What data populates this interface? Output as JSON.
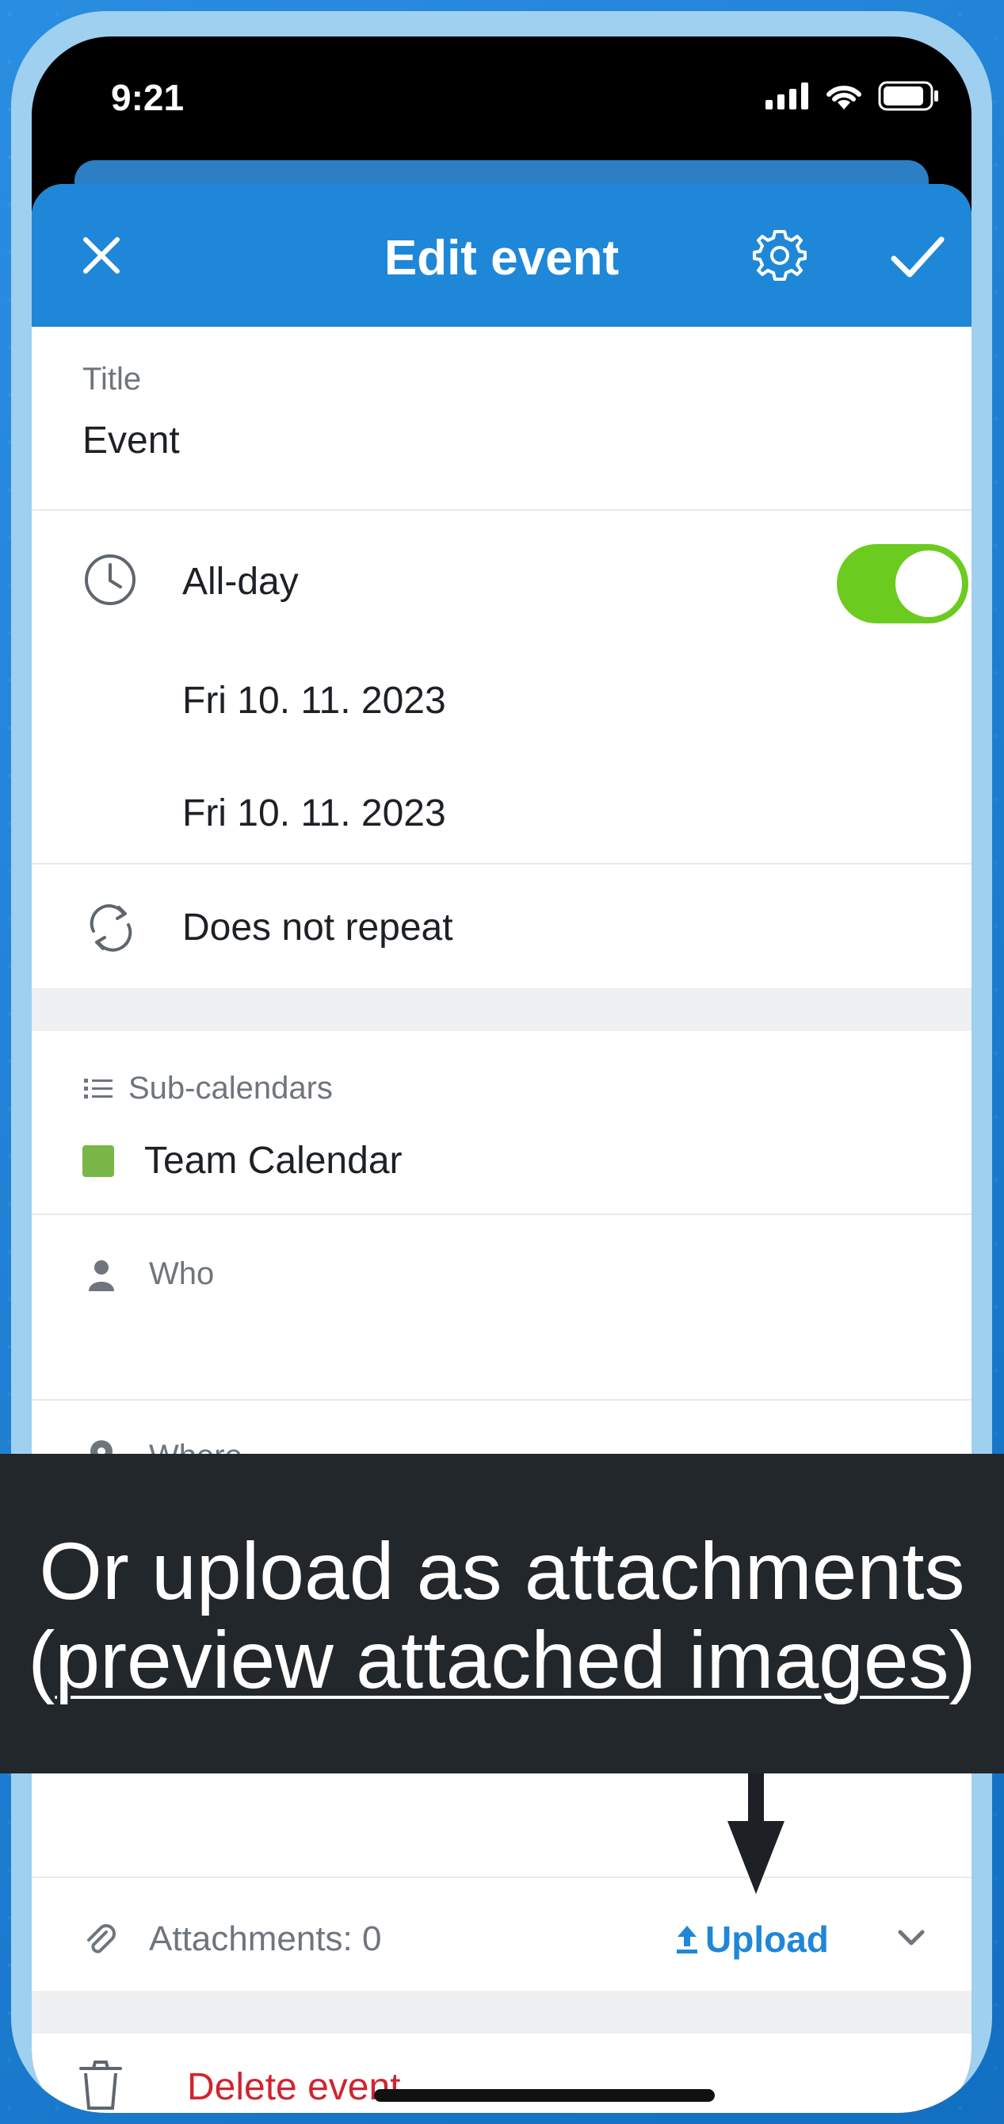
{
  "status": {
    "time": "9:21"
  },
  "header": {
    "title": "Edit event"
  },
  "title_field": {
    "label": "Title",
    "value": "Event"
  },
  "allday": {
    "label": "All-day",
    "enabled": true,
    "toggle_color": "#6ccb1f"
  },
  "dates": {
    "start": "Fri 10. 11. 2023",
    "end": "Fri 10. 11. 2023"
  },
  "repeat": {
    "label": "Does not repeat"
  },
  "subcalendars": {
    "label": "Sub-calendars",
    "item": "Team Calendar",
    "item_color": "#7ab648"
  },
  "who": {
    "label": "Who"
  },
  "where": {
    "label": "Where"
  },
  "attachments": {
    "label": "Attachments: 0",
    "upload_label": "Upload"
  },
  "delete": {
    "label": "Delete event"
  },
  "overlay": {
    "line1": "Or upload as attachments",
    "line2_open": "(",
    "line2_link": "preview attached images",
    "line2_close": ")"
  },
  "colors": {
    "header": "#1f87d7",
    "accent": "#1f87d7",
    "danger": "#d1242f"
  }
}
